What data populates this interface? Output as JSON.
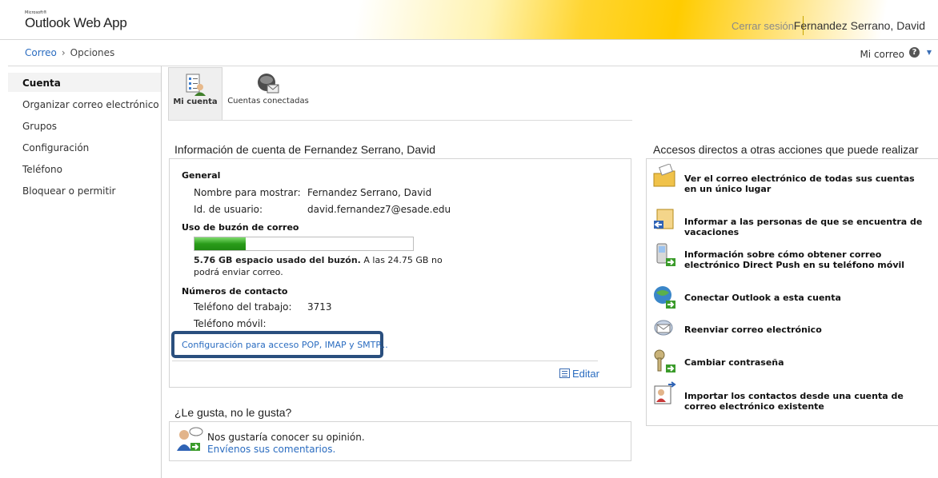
{
  "header": {
    "brand_small": "Microsoft®",
    "brand": "Outlook Web App",
    "signout": "Cerrar sesión",
    "user": "Fernandez Serrano, David"
  },
  "breadcrumb": {
    "root": "Correo",
    "separator": "›",
    "current": "Opciones"
  },
  "toolbar": {
    "my_mail": "Mi correo",
    "help_symbol": "?",
    "caret": "▼"
  },
  "nav": [
    {
      "label": "Cuenta",
      "active": true
    },
    {
      "label": "Organizar correo electrónico"
    },
    {
      "label": "Grupos"
    },
    {
      "label": "Configuración"
    },
    {
      "label": "Teléfono"
    },
    {
      "label": "Bloquear o permitir"
    }
  ],
  "tabs": [
    {
      "label": "Mi cuenta",
      "icon": "my-account-icon"
    },
    {
      "label": "Cuentas conectadas",
      "icon": "connected-accounts-icon"
    }
  ],
  "account": {
    "title": "Información de cuenta de Fernandez Serrano, David",
    "general_heading": "General",
    "display_name_label": "Nombre para mostrar:",
    "display_name_value": "Fernandez Serrano, David",
    "user_id_label": "Id. de usuario:",
    "user_id_value": "david.fernandez7@esade.edu",
    "mailbox_heading": "Uso de buzón de correo",
    "usage_fraction": 0.233,
    "usage_bold": "5.76 GB espacio usado del buzón.",
    "usage_rest_1": " A las 24.75 GB no",
    "usage_rest_2": "podrá enviar correo.",
    "contact_heading": "Números de contacto",
    "work_phone_label": "Teléfono del trabajo:",
    "work_phone_value": "3713",
    "mobile_label": "Teléfono móvil:",
    "pop_link": "Configuración para acceso POP, IMAP y SMTP...",
    "edit": "Editar"
  },
  "feedback": {
    "title": "¿Le gusta, no le gusta?",
    "text": "Nos gustaría conocer su opinión.",
    "link": "Envíenos sus comentarios."
  },
  "shortcuts": {
    "title": "Accesos directos a otras acciones que puede realizar",
    "items": [
      {
        "label": "Ver el correo electrónico de todas sus cuentas en un único lugar",
        "icon": "folder-mail-icon"
      },
      {
        "label": "Informar a las personas de que se encuentra de vacaciones",
        "icon": "out-of-office-icon"
      },
      {
        "label": "Información sobre cómo obtener correo electrónico Direct Push en su teléfono móvil",
        "icon": "mobile-phone-icon"
      },
      {
        "label": "Conectar Outlook a esta cuenta",
        "icon": "globe-outlook-icon"
      },
      {
        "label": "Reenviar correo electrónico",
        "icon": "forward-mail-icon"
      },
      {
        "label": "Cambiar contraseña",
        "icon": "keys-icon"
      },
      {
        "label": "Importar los contactos desde una cuenta de correo electrónico existente",
        "icon": "import-contacts-icon"
      }
    ]
  },
  "colors": {
    "accent": "#ffcc00",
    "link": "#2a6cc0",
    "highlight": "#2a4f7e",
    "progress": "#2a9c1a"
  }
}
